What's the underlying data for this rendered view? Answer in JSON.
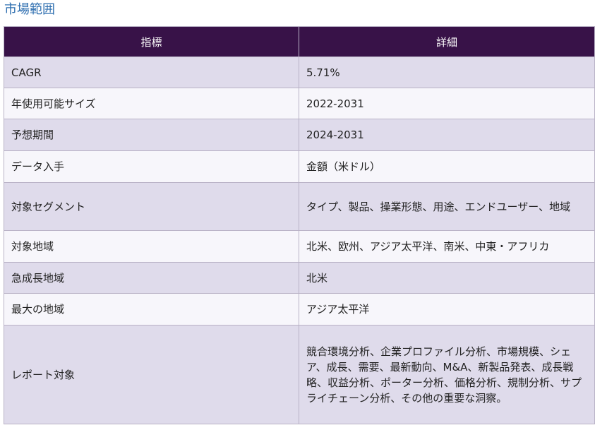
{
  "section_title": "市場範囲",
  "table": {
    "header": {
      "metric": "指標",
      "details": "詳細"
    },
    "rows": [
      {
        "label": "CAGR",
        "value": "5.71%"
      },
      {
        "label": "年使用可能サイズ",
        "value": "2022-2031"
      },
      {
        "label": "予想期間",
        "value": "2024-2031"
      },
      {
        "label": "データ入手",
        "value": "金額（米ドル）"
      },
      {
        "label": "対象セグメント",
        "value": "タイプ、製品、操業形態、用途、エンドユーザー、地域"
      },
      {
        "label": "対象地域",
        "value": "北米、欧州、アジア太平洋、南米、中東・アフリカ"
      },
      {
        "label": "急成長地域",
        "value": "北米"
      },
      {
        "label": "最大の地域",
        "value": "アジア太平洋"
      },
      {
        "label": "レポート対象",
        "value": "競合環境分析、企業プロファイル分析、市場規模、シェア、成長、需要、最新動向、M&A、新製品発表、成長戦略、収益分析、ポーター分析、価格分析、規制分析、サプライチェーン分析、その他の重要な洞察。"
      }
    ]
  }
}
